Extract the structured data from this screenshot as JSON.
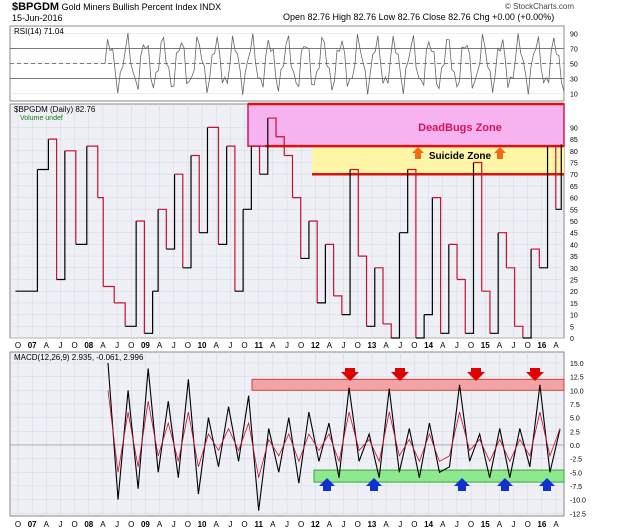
{
  "header": {
    "symbol": "$BPGDM",
    "name": "Gold Miners Bullish Percent Index",
    "exchange": "INDX",
    "date": "15-Jun-2016",
    "quote": "Open 82.76  High 82.76  Low 82.76  Close 82.76  Chg +0.00 (+0.00%)",
    "credit": "© StockCharts.com"
  },
  "chart_data": [
    {
      "type": "line",
      "panel": "rsi",
      "label": "RSI(14) 71.04",
      "ylim": [
        0,
        100
      ],
      "yticks": [
        "10",
        "30",
        "50",
        "70",
        "90"
      ],
      "reference_lines": [
        30,
        50,
        70
      ],
      "last_value": 71.04
    },
    {
      "type": "line",
      "panel": "price",
      "label": "$BPGDM (Daily) 82.76",
      "sublabel": "Volume undef",
      "ylim": [
        0,
        100
      ],
      "yticks": [
        "0",
        "5",
        "10",
        "15",
        "20",
        "25",
        "30",
        "35",
        "40",
        "45",
        "50",
        "55",
        "60",
        "65",
        "70",
        "75",
        "80",
        "85",
        "90"
      ],
      "last_value": 82.76,
      "zones": [
        {
          "label": "DeadBugs Zone",
          "from": 82,
          "to": 100,
          "color": "#f7b3f0"
        },
        {
          "label": "Suicide Zone",
          "from": 70,
          "to": 82,
          "color": "#fff6a8"
        }
      ],
      "series_colors": {
        "up": "#000000",
        "down": "#c8102e"
      },
      "x": [
        2006.5,
        2006.9,
        2007.1,
        2007.25,
        2007.4,
        2007.6,
        2007.8,
        2008.0,
        2008.1,
        2008.3,
        2008.5,
        2008.7,
        2008.85,
        2009.0,
        2009.1,
        2009.25,
        2009.4,
        2009.55,
        2009.7,
        2009.85,
        2010.0,
        2010.2,
        2010.35,
        2010.5,
        2010.65,
        2010.8,
        2010.95,
        2011.1,
        2011.25,
        2011.4,
        2011.55,
        2011.7,
        2011.85,
        2012.0,
        2012.15,
        2012.3,
        2012.45,
        2012.6,
        2012.75,
        2012.9,
        2013.05,
        2013.2,
        2013.35,
        2013.5,
        2013.65,
        2013.8,
        2013.95,
        2014.1,
        2014.25,
        2014.4,
        2014.55,
        2014.7,
        2014.85,
        2015.0,
        2015.15,
        2015.3,
        2015.45,
        2015.6,
        2015.75,
        2015.9,
        2016.05,
        2016.2,
        2016.35,
        2016.45
      ],
      "y": [
        20,
        72,
        85,
        25,
        80,
        40,
        82,
        60,
        22,
        15,
        5,
        50,
        2,
        20,
        55,
        38,
        70,
        30,
        78,
        45,
        90,
        40,
        82,
        20,
        55,
        82,
        70,
        94,
        86,
        78,
        60,
        34,
        50,
        15,
        40,
        18,
        10,
        72,
        35,
        5,
        30,
        6,
        0,
        45,
        72,
        0,
        10,
        60,
        2,
        40,
        25,
        2,
        75,
        20,
        2,
        45,
        30,
        5,
        0,
        38,
        30,
        82,
        55,
        82.76
      ]
    },
    {
      "type": "line",
      "panel": "macd",
      "label": "MACD(12,26,9) 2.935, -0.061, 2.996",
      "ylim": [
        -13,
        17
      ],
      "yticks": [
        "-12.5",
        "-10.0",
        "-7.5",
        "-5.0",
        "-2.5",
        "0.0",
        "2.5",
        "5.0",
        "7.5",
        "10.0",
        "12.5",
        "15.0"
      ],
      "zones": [
        {
          "label": "",
          "from": 10,
          "to": 12,
          "color": "#f4a4a4"
        },
        {
          "label": "",
          "from": -6.8,
          "to": -4.6,
          "color": "#8ee88e"
        }
      ],
      "series": [
        {
          "name": "MACD",
          "values": [
            15,
            -10,
            10,
            -8,
            14,
            -5,
            8,
            -6,
            12,
            -9,
            5,
            -4,
            7,
            -3,
            9,
            -12,
            3,
            -5,
            5,
            -7,
            6,
            -3,
            4,
            -6,
            10.5,
            -3,
            2,
            -6,
            10.3,
            -5,
            3,
            -6,
            4,
            -5,
            -4,
            11,
            -3,
            2,
            -6,
            3,
            -6,
            3,
            -4,
            11,
            -5,
            2.9
          ]
        },
        {
          "name": "Signal",
          "values": [
            10,
            -5,
            6,
            -4,
            8,
            -2,
            4,
            -3,
            6,
            -4,
            2,
            -1,
            3,
            -1,
            4,
            -6,
            1,
            -2,
            2,
            -3,
            2,
            -1,
            2,
            -3,
            6,
            -1,
            1,
            -3,
            6,
            -2,
            1,
            -3,
            2,
            -3,
            -2,
            6,
            -1,
            1,
            -3,
            1,
            -3,
            1,
            -2,
            6,
            -2,
            3.0
          ]
        }
      ]
    }
  ],
  "x_axis": {
    "ticks": [
      "O",
      "07",
      "A",
      "J",
      "O",
      "08",
      "A",
      "J",
      "O",
      "09",
      "A",
      "J",
      "O",
      "10",
      "A",
      "J",
      "O",
      "11",
      "A",
      "J",
      "O",
      "12",
      "A",
      "J",
      "O",
      "13",
      "A",
      "J",
      "O",
      "14",
      "A",
      "J",
      "O",
      "15",
      "A",
      "J",
      "O",
      "16",
      "A"
    ]
  },
  "annotations": {
    "deadbugs_label": "DeadBugs Zone",
    "suicide_label": "Suicide Zone"
  }
}
